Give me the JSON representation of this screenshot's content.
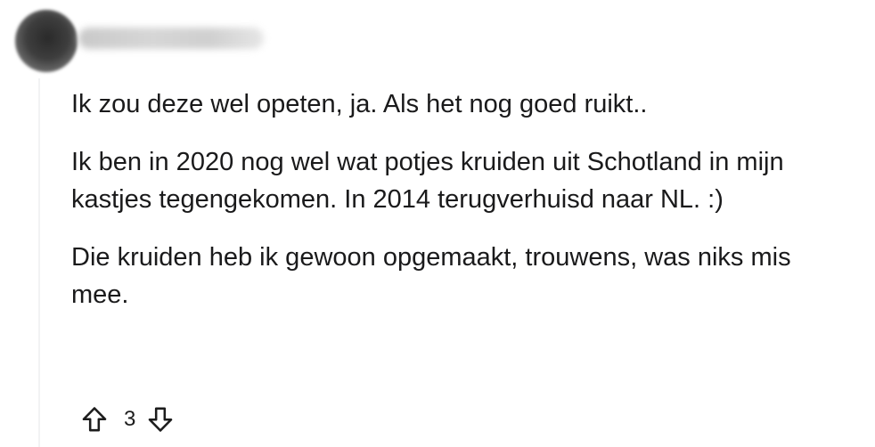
{
  "comment": {
    "author": {
      "username": "",
      "avatar_icon": "avatar-icon"
    },
    "paragraphs": [
      "Ik zou deze wel opeten, ja. Als het nog goed ruikt..",
      "Ik ben in 2020 nog wel wat potjes kruiden uit Schotland in mijn kastjes tegengekomen. In 2014 terugverhuisd naar NL. :)",
      "Die kruiden heb ik gewoon opgemaakt, trouwens, was niks mis mee."
    ],
    "score": "3",
    "actions": {
      "upvote_icon": "arrow-up-icon",
      "downvote_icon": "arrow-down-icon"
    }
  }
}
